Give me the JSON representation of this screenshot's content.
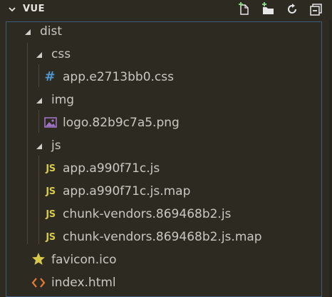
{
  "header": {
    "title": "VUE",
    "actions": [
      "new-file-icon",
      "new-folder-icon",
      "refresh-icon",
      "collapse-all-icon"
    ]
  },
  "tree": {
    "dist": "dist",
    "css": "css",
    "css_file": "app.e2713bb0.css",
    "img": "img",
    "img_file": "logo.82b9c7a5.png",
    "js": "js",
    "js_files": [
      "app.a990f71c.js",
      "app.a990f71c.js.map",
      "chunk-vendors.869468b2.js",
      "chunk-vendors.869468b2.js.map"
    ],
    "favicon": "favicon.ico",
    "index": "index.html"
  },
  "colors": {
    "background": "#2d2a22",
    "css_icon": "#4f97cf",
    "js_icon": "#d6c94a",
    "favicon_icon": "#d6c94a",
    "html_icon": "#e37933",
    "image_icon": "#a074c4"
  }
}
